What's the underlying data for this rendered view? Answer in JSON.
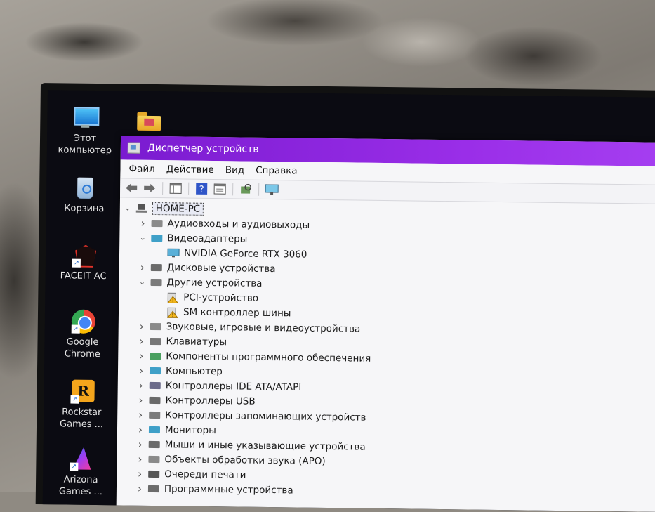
{
  "desktop": {
    "icons": [
      {
        "label": "Этот компьютер",
        "icon": "this-pc-icon"
      },
      {
        "label": "Корзина",
        "icon": "recycle-bin-icon"
      },
      {
        "label": "FACEIT AC",
        "icon": "faceit-icon"
      },
      {
        "label": "Google Chrome",
        "icon": "chrome-icon"
      },
      {
        "label": "Rockstar Games ...",
        "icon": "rockstar-icon"
      },
      {
        "label": "Arizona Games ...",
        "icon": "arizona-icon"
      }
    ],
    "folder_icon": "folder-icon"
  },
  "window": {
    "title": "Диспетчер устройств",
    "accent": "#8a22de",
    "menu": [
      "Файл",
      "Действие",
      "Вид",
      "Справка"
    ],
    "toolbar": [
      "back-icon",
      "forward-icon",
      "properties-pane-icon",
      "help-icon",
      "details-icon",
      "scan-hardware-icon",
      "monitor-icon"
    ]
  },
  "tree": {
    "root": "HOME-PC",
    "items": [
      {
        "label": "Аудиовходы и аудиовыходы",
        "expanded": false
      },
      {
        "label": "Видеоадаптеры",
        "expanded": true,
        "children": [
          "NVIDIA GeForce RTX 3060"
        ]
      },
      {
        "label": "Дисковые устройства",
        "expanded": false
      },
      {
        "label": "Другие устройства",
        "expanded": true,
        "children": [
          "PCI-устройство",
          "SM контроллер шины"
        ]
      },
      {
        "label": "Звуковые, игровые и видеоустройства",
        "expanded": false
      },
      {
        "label": "Клавиатуры",
        "expanded": false
      },
      {
        "label": "Компоненты программного обеспечения",
        "expanded": false
      },
      {
        "label": "Компьютер",
        "expanded": false
      },
      {
        "label": "Контроллеры IDE ATA/ATAPI",
        "expanded": false
      },
      {
        "label": "Контроллеры USB",
        "expanded": false
      },
      {
        "label": "Контроллеры запоминающих устройств",
        "expanded": false
      },
      {
        "label": "Мониторы",
        "expanded": false
      },
      {
        "label": "Мыши и иные указывающие устройства",
        "expanded": false
      },
      {
        "label": "Объекты обработки звука (APO)",
        "expanded": false
      },
      {
        "label": "Очереди печати",
        "expanded": false
      },
      {
        "label": "Программные устройства",
        "expanded": false
      }
    ]
  }
}
